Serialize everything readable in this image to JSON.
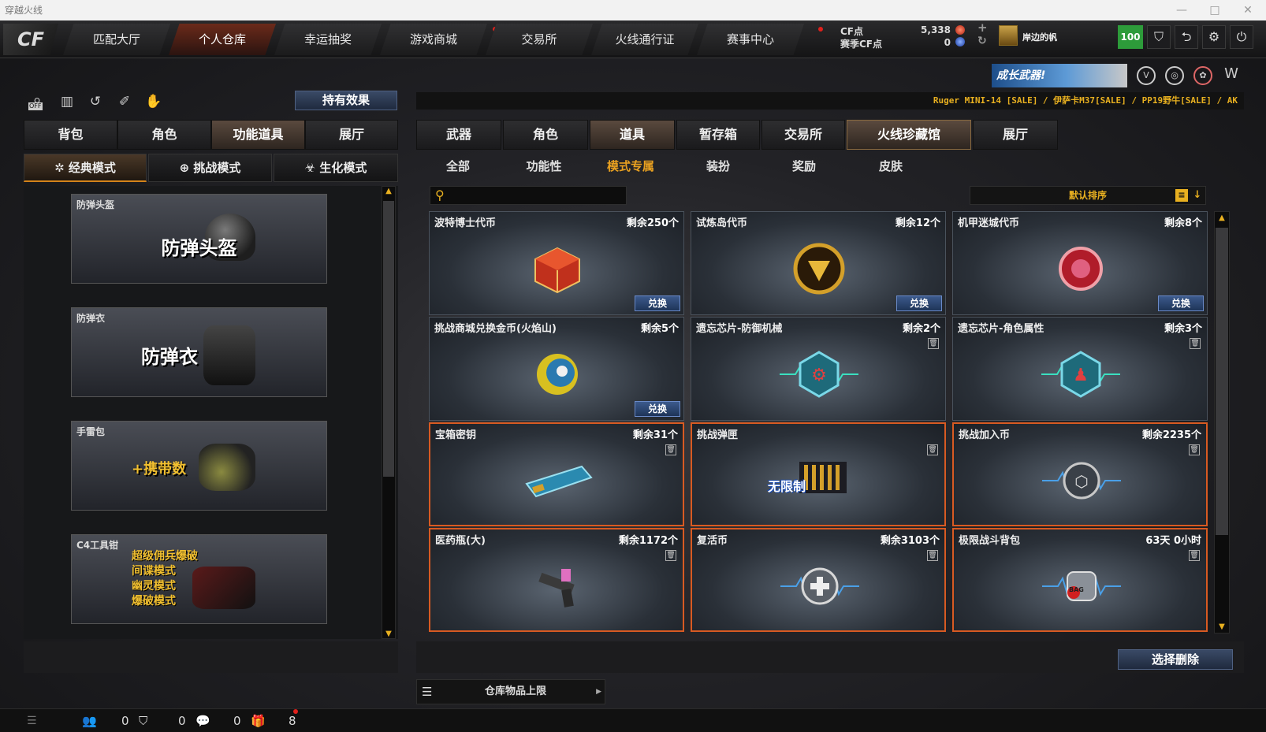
{
  "window": {
    "title": "穿越火线",
    "controls": [
      "—",
      "□",
      "✕"
    ]
  },
  "logo": "CF",
  "nav": {
    "tabs": [
      {
        "label": "匹配大厅",
        "active": false,
        "dot": false
      },
      {
        "label": "个人仓库",
        "active": true,
        "dot": false
      },
      {
        "label": "幸运抽奖",
        "active": false,
        "dot": false
      },
      {
        "label": "游戏商城",
        "active": false,
        "dot": true
      },
      {
        "label": "交易所",
        "active": false,
        "dot": false
      },
      {
        "label": "火线通行证",
        "active": false,
        "dot": false
      },
      {
        "label": "赛事中心",
        "active": false,
        "dot": true
      }
    ],
    "cf_label": "CF点",
    "cf_value": "5,338",
    "season_label": "赛季CF点",
    "season_value": "0",
    "plus": "+",
    "refresh": "↻",
    "username": "岸边的帆",
    "level": "100"
  },
  "promo": {
    "text": "成长武器!"
  },
  "marquee": "Ruger MINI-14  [SALE] / 伊萨卡M37[SALE] / PP19野牛[SALE] / AK",
  "left": {
    "effect_button": "持有效果",
    "off_label": "OFF",
    "tabs": [
      {
        "label": "背包",
        "active": false
      },
      {
        "label": "角色",
        "active": false
      },
      {
        "label": "功能道具",
        "active": true
      },
      {
        "label": "展厅",
        "active": false
      }
    ],
    "modes": [
      {
        "label": "经典模式",
        "icon": "✲",
        "active": true
      },
      {
        "label": "挑战模式",
        "icon": "⊕",
        "active": false
      },
      {
        "label": "生化模式",
        "icon": "☣",
        "active": false
      }
    ],
    "items": [
      {
        "name": "防弹头盔",
        "big": "防弹头盔"
      },
      {
        "name": "防弹衣",
        "big": "防弹衣"
      },
      {
        "name": "手雷包",
        "big": "+携带数"
      },
      {
        "name": "C4工具钳",
        "lines": [
          "超级佣兵爆破",
          "间谍模式",
          "幽灵模式",
          "爆破模式"
        ]
      }
    ]
  },
  "right": {
    "tabs": [
      {
        "label": "武器",
        "active": false
      },
      {
        "label": "角色",
        "active": false
      },
      {
        "label": "道具",
        "active": true
      },
      {
        "label": "暂存箱",
        "active": false
      },
      {
        "label": "交易所",
        "active": false
      },
      {
        "label": "火线珍藏馆",
        "active": true
      },
      {
        "label": "展厅",
        "active": false
      }
    ],
    "subtabs": [
      {
        "label": "全部",
        "active": false
      },
      {
        "label": "功能性",
        "active": false
      },
      {
        "label": "模式专属",
        "active": true
      },
      {
        "label": "装扮",
        "active": false
      },
      {
        "label": "奖励",
        "active": false
      },
      {
        "label": "皮肤",
        "active": false
      }
    ],
    "search_placeholder": "",
    "sort_label": "默认排序",
    "items": [
      {
        "name": "波特博士代币",
        "qty": "剩余250个",
        "action": "兑换",
        "trash": false,
        "highlight": false,
        "icon": "cube-token-icon"
      },
      {
        "name": "试炼岛代币",
        "qty": "剩余12个",
        "action": "兑换",
        "trash": false,
        "highlight": false,
        "icon": "gold-coin-icon"
      },
      {
        "name": "机甲迷城代币",
        "qty": "剩余8个",
        "action": "兑换",
        "trash": false,
        "highlight": false,
        "icon": "red-coin-icon"
      },
      {
        "name": "挑战商城兑换金币(火焰山)",
        "qty": "剩余5个",
        "action": "兑换",
        "trash": false,
        "highlight": false,
        "icon": "eye-coin-icon"
      },
      {
        "name": "遗忘芯片-防御机械",
        "qty": "剩余2个",
        "action": "",
        "trash": true,
        "highlight": false,
        "icon": "chip-icon"
      },
      {
        "name": "遗忘芯片-角色属性",
        "qty": "剩余3个",
        "action": "",
        "trash": true,
        "highlight": false,
        "icon": "chip-icon"
      },
      {
        "name": "宝箱密钥",
        "qty": "剩余31个",
        "action": "",
        "trash": true,
        "highlight": true,
        "icon": "key-card-icon"
      },
      {
        "name": "挑战弹匣",
        "qty": "",
        "action": "",
        "trash": true,
        "highlight": true,
        "icon": "ammo-icon",
        "overlay": "无限制"
      },
      {
        "name": "挑战加入币",
        "qty": "剩余2235个",
        "action": "",
        "trash": true,
        "highlight": true,
        "icon": "join-coin-icon"
      },
      {
        "name": "医药瓶(大)",
        "qty": "剩余1172个",
        "action": "",
        "trash": true,
        "highlight": true,
        "icon": "med-gun-icon"
      },
      {
        "name": "复活币",
        "qty": "剩余3103个",
        "action": "",
        "trash": true,
        "highlight": true,
        "icon": "revive-coin-icon"
      },
      {
        "name": "极限战斗背包",
        "qty": "63天 0小时",
        "action": "",
        "trash": true,
        "highlight": true,
        "icon": "bag-icon",
        "bag_label": "BAG"
      }
    ],
    "delete_button": "选择删除",
    "capacity_label": "仓库物品上限"
  },
  "bottom": {
    "counts": [
      "0",
      "0",
      "0",
      "8"
    ]
  },
  "colors": {
    "accent": "#e8b020",
    "highlight": "#d85a22",
    "active_tab": "#6b2a1a",
    "level": "#2d9b3a"
  }
}
